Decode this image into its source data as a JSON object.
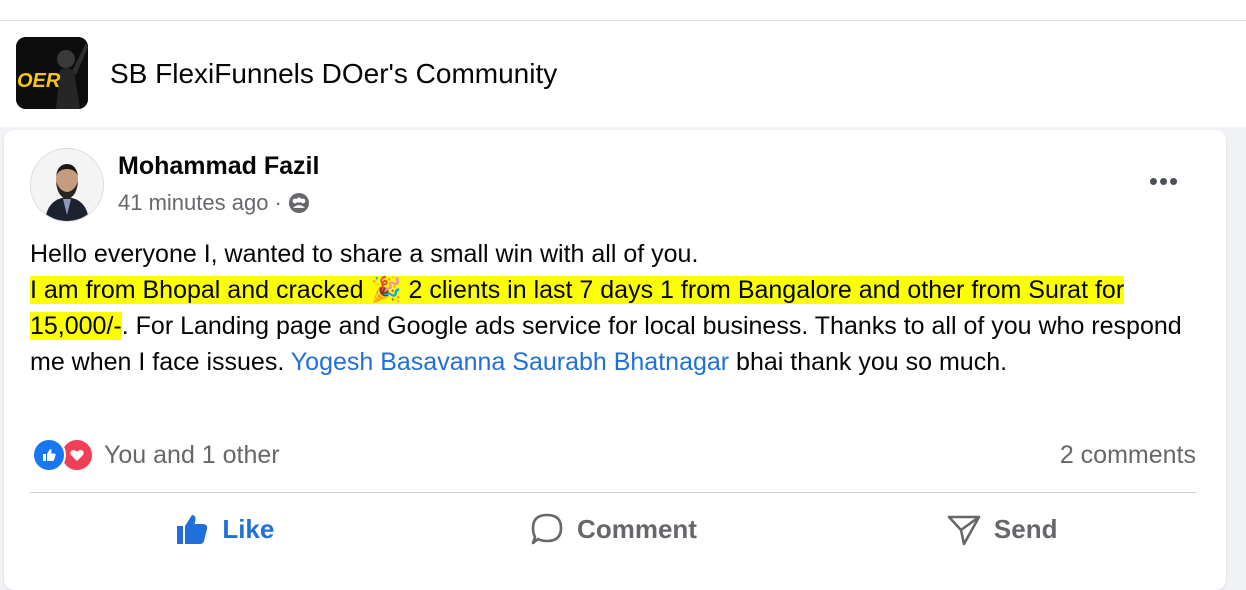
{
  "group": {
    "name": "SB FlexiFunnels DOer's Community",
    "avatar_text": "OER"
  },
  "post": {
    "author": "Mohammad Fazil",
    "time": "41 minutes ago",
    "separator": "·",
    "privacy_icon": "group-members-icon",
    "more_label": "•••",
    "body": {
      "line1": "Hello everyone I, wanted to share a small win with all of you.",
      "highlight": "I am from Bhopal and cracked 🎉 2 clients in last 7 days 1 from Bangalore and other from Surat for 15,000/-",
      "rest": ". For Landing page and Google ads service for local business. Thanks to all of you who respond me when I face issues. ",
      "mention": "Yogesh Basavanna Saurabh Bhatnagar",
      "tail": " bhai thank you so much."
    },
    "reactions_text": "You and 1 other",
    "comments_text": "2 comments",
    "actions": {
      "like": "Like",
      "comment": "Comment",
      "send": "Send"
    }
  },
  "colors": {
    "accent": "#216fdb",
    "highlight": "#fcff00",
    "muted": "#65676b"
  }
}
